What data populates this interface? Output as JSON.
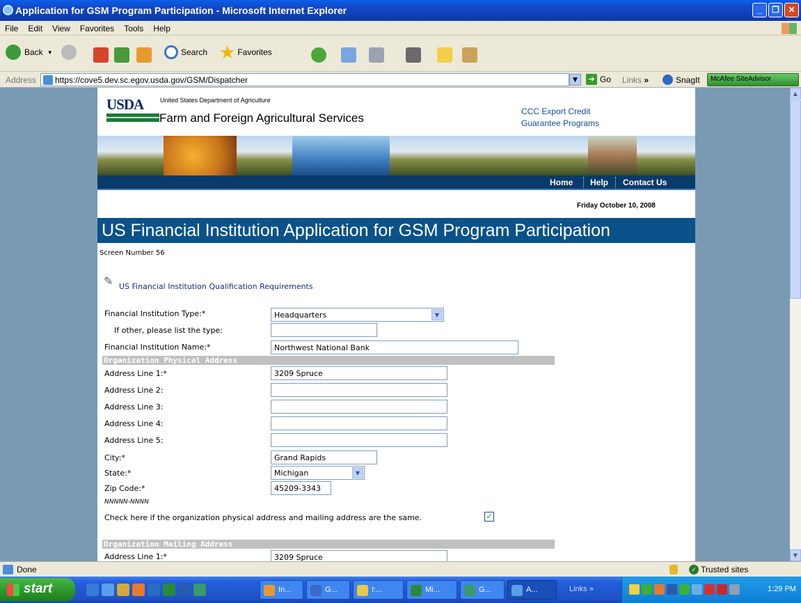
{
  "window": {
    "title": "Application for GSM Program Participation - Microsoft Internet Explorer"
  },
  "menu": [
    "File",
    "Edit",
    "View",
    "Favorites",
    "Tools",
    "Help"
  ],
  "toolbar": {
    "back": "Back",
    "search": "Search",
    "favorites": "Favorites"
  },
  "address": {
    "label": "Address",
    "url": "https://cove5.dev.sc.egov.usda.gov/GSM/Dispatcher",
    "go": "Go",
    "links": "Links",
    "snagit": "SnagIt",
    "mcafee": "McAfee SiteAdvisor"
  },
  "header": {
    "logo": "USDA",
    "dept": "United States Department of Agriculture",
    "agency": "Farm and Foreign Agricultural Services",
    "program_line1": "CCC Export Credit",
    "program_line2": "Guarantee Programs"
  },
  "nav": [
    "Home",
    "Help",
    "Contact Us"
  ],
  "date": "Friday October 10, 2008",
  "page_title": "US Financial Institution Application for GSM Program Participation",
  "screen_number": "Screen Number 56",
  "qualification_link": "US Financial Institution Qualification Requirements",
  "form": {
    "fi_type_label": "Financial Institution Type:*",
    "fi_type_value": "Headquarters",
    "other_label": "If other, please list the type:",
    "other_value": "",
    "fi_name_label": "Financial Institution Name:*",
    "fi_name_value": "Northwest National Bank",
    "physical_header": "Organization Physical Address",
    "addr1_label": "Address Line 1:*",
    "addr1_value": "3209 Spruce",
    "addr2_label": "Address Line 2:",
    "addr3_label": "Address Line 3:",
    "addr4_label": "Address Line 4:",
    "addr5_label": "Address Line 5:",
    "city_label": "City:*",
    "city_value": "Grand Rapids",
    "state_label": "State:*",
    "state_value": "Michigan",
    "zip_label": "Zip Code:*",
    "zip_value": "45209-3343",
    "zip_format": "NNNNN-NNNN",
    "same_address_label": "Check here if the organization physical address and mailing address are the same.",
    "same_address_checked": true,
    "mailing_header": "Organization Mailing Address",
    "mail_addr1_label": "Address Line 1:*",
    "mail_addr1_value": "3209 Spruce"
  },
  "status": {
    "text": "Done",
    "zone": "Trusted sites"
  },
  "taskbar": {
    "start": "start",
    "tasks": [
      "In...",
      "G...",
      "I:...",
      "Mi...",
      "G...",
      "A..."
    ],
    "links": "Links",
    "clock": "1:29 PM"
  }
}
